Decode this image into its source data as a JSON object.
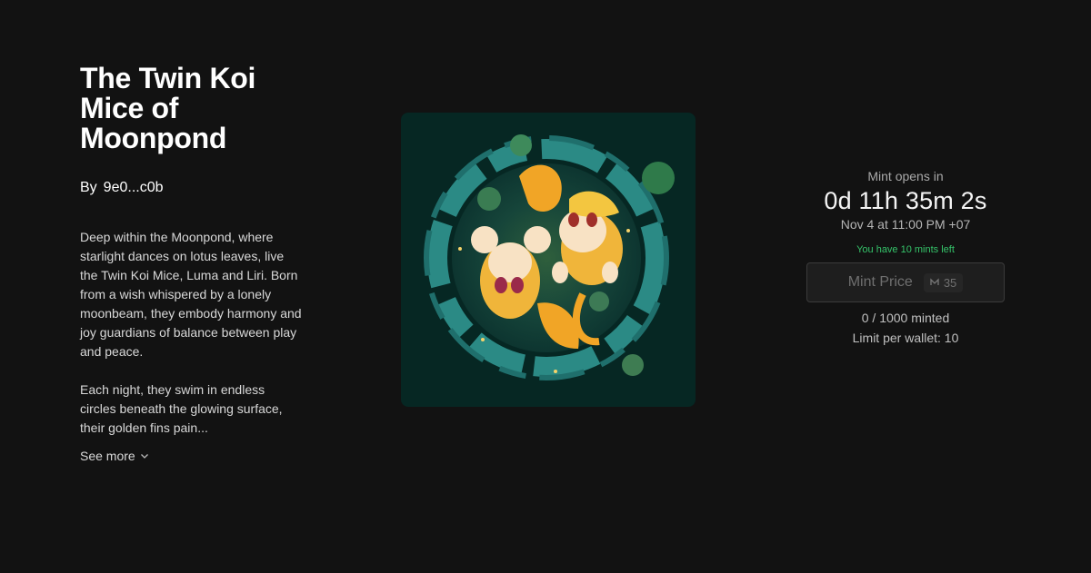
{
  "collection": {
    "title_lines": [
      "The Twin Koi",
      "Mice of",
      "Moonpond"
    ],
    "by_label": "By",
    "creator": "9e0...c0b",
    "description": [
      "Deep within the Moonpond, where starlight dances on lotus leaves, live the Twin Koi Mice, Luma and Liri. Born from a wish whispered by a lonely moonbeam, they embody harmony and joy guardians of balance between play and peace.",
      "Each night, they swim in endless circles beneath the glowing surface, their golden fins pain..."
    ],
    "see_more_label": "See more"
  },
  "mint": {
    "opens_label": "Mint opens in",
    "countdown": "0d 11h 35m 2s",
    "open_date": "Nov 4 at 11:00 PM +07",
    "mints_left": "You have 10 mints left",
    "button_label": "Mint Price",
    "price": "35",
    "price_icon": "currency-icon",
    "minted": "0 / 1000 minted",
    "limit": "Limit per wallet: 10"
  },
  "colors": {
    "background": "#121212",
    "accent_green": "#35c46a",
    "artwork_bg": "#062723"
  }
}
